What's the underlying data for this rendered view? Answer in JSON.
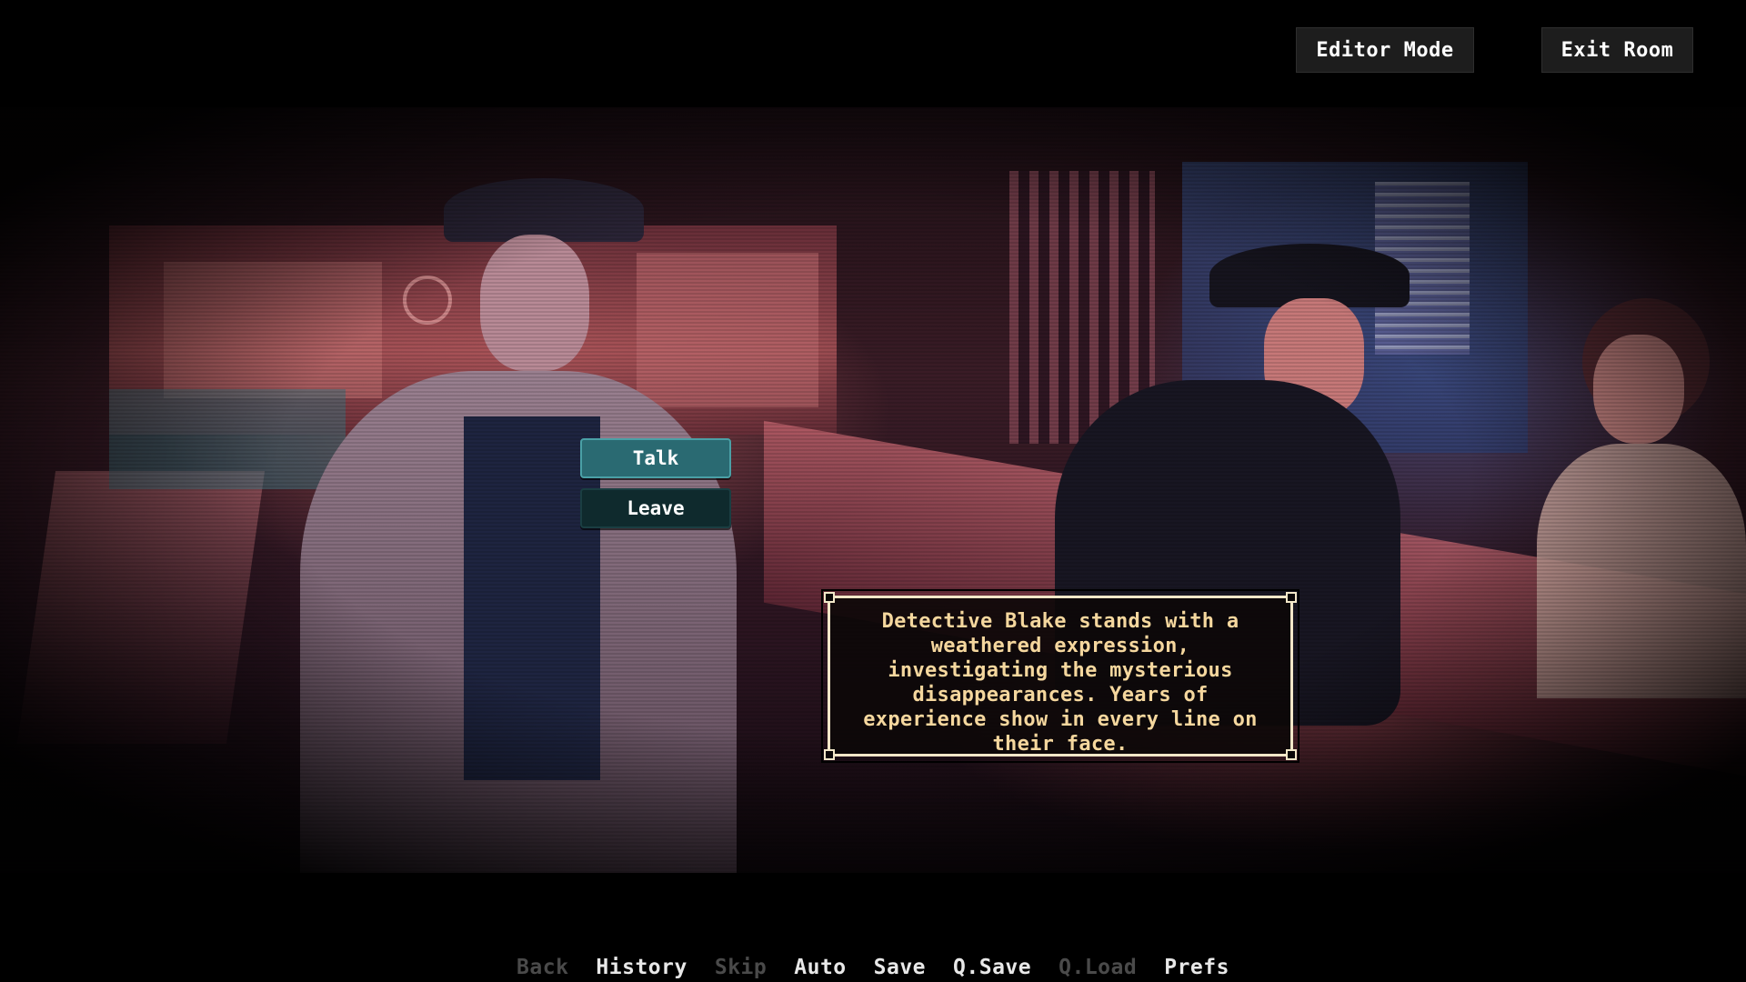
{
  "top_bar": {
    "editor_mode_label": "Editor Mode",
    "exit_room_label": "Exit Room"
  },
  "choices": [
    {
      "label": "Talk",
      "selected": true
    },
    {
      "label": "Leave",
      "selected": false
    }
  ],
  "dialogue": {
    "text": "Detective Blake stands with a weathered expression, investigating the mysterious disappearances. Years of experience show in every line on their face."
  },
  "quick_menu": {
    "items": [
      {
        "label": "Back",
        "enabled": false
      },
      {
        "label": "History",
        "enabled": true
      },
      {
        "label": "Skip",
        "enabled": false
      },
      {
        "label": "Auto",
        "enabled": true
      },
      {
        "label": "Save",
        "enabled": true
      },
      {
        "label": "Q.Save",
        "enabled": true
      },
      {
        "label": "Q.Load",
        "enabled": false
      },
      {
        "label": "Prefs",
        "enabled": true
      }
    ]
  },
  "colors": {
    "background": "#000000",
    "button_bg": "#1d1d1d",
    "choice_selected": "#2a6a72",
    "choice_normal": "#0f2a2d",
    "dialogue_text": "#f5d79e",
    "dialogue_border": "#f2e7c8",
    "menu_enabled": "#e8e8e8",
    "menu_disabled": "#4a4a4a"
  }
}
